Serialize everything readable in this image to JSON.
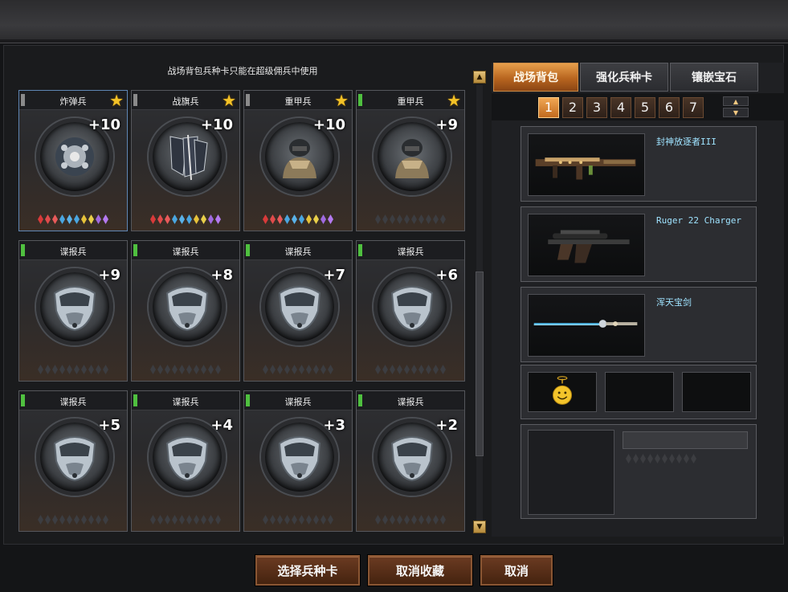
{
  "notice": "战场背包兵种卡只能在超级佣兵中使用",
  "cards": [
    {
      "name": "炸弹兵",
      "level": "+10",
      "star": true,
      "flag_color": "#8a8a8a",
      "emblem": "bomb-emblem-icon",
      "gems": "colored"
    },
    {
      "name": "战旗兵",
      "level": "+10",
      "star": true,
      "flag_color": "#8a8a8a",
      "emblem": "flag-emblem-icon",
      "gems": "colored"
    },
    {
      "name": "重甲兵",
      "level": "+10",
      "star": true,
      "flag_color": "#8a8a8a",
      "emblem": "heavy-armor-emblem-icon",
      "gems": "colored"
    },
    {
      "name": "重甲兵",
      "level": "+9",
      "star": true,
      "flag_color": "#4fc03f",
      "emblem": "heavy-armor-emblem-icon",
      "gems": "empty"
    },
    {
      "name": "谍报兵",
      "level": "+9",
      "star": false,
      "flag_color": "#4fc03f",
      "emblem": "spy-mask-emblem-icon",
      "gems": "empty"
    },
    {
      "name": "谍报兵",
      "level": "+8",
      "star": false,
      "flag_color": "#4fc03f",
      "emblem": "spy-mask-emblem-icon",
      "gems": "empty"
    },
    {
      "name": "谍报兵",
      "level": "+7",
      "star": false,
      "flag_color": "#4fc03f",
      "emblem": "spy-mask-emblem-icon",
      "gems": "empty"
    },
    {
      "name": "谍报兵",
      "level": "+6",
      "star": false,
      "flag_color": "#4fc03f",
      "emblem": "spy-mask-emblem-icon",
      "gems": "empty"
    },
    {
      "name": "谍报兵",
      "level": "+5",
      "star": false,
      "flag_color": "#4fc03f",
      "emblem": "spy-mask-emblem-icon",
      "gems": "empty"
    },
    {
      "name": "谍报兵",
      "level": "+4",
      "star": false,
      "flag_color": "#4fc03f",
      "emblem": "spy-mask-emblem-icon",
      "gems": "empty"
    },
    {
      "name": "谍报兵",
      "level": "+3",
      "star": false,
      "flag_color": "#4fc03f",
      "emblem": "spy-mask-emblem-icon",
      "gems": "empty"
    },
    {
      "name": "谍报兵",
      "level": "+2",
      "star": false,
      "flag_color": "#4fc03f",
      "emblem": "spy-mask-emblem-icon",
      "gems": "empty"
    }
  ],
  "tabs": [
    {
      "label": "战场背包",
      "active": true
    },
    {
      "label": "强化兵种卡",
      "active": false
    },
    {
      "label": "镶嵌宝石",
      "active": false
    }
  ],
  "pages": [
    "1",
    "2",
    "3",
    "4",
    "5",
    "6",
    "7"
  ],
  "active_page": "1",
  "weapons": [
    {
      "name": "封神放逐者III",
      "image": "machine-gun-icon"
    },
    {
      "name": "Ruger 22 Charger",
      "image": "scoped-pistol-icon"
    },
    {
      "name": "浑天宝剑",
      "image": "sword-icon"
    }
  ],
  "accessory_slots": [
    "smiley-face-icon",
    "empty-slot",
    "empty-slot"
  ],
  "buttons": {
    "select": "选择兵种卡",
    "unfavorite": "取消收藏",
    "cancel": "取消"
  },
  "colors": {
    "accent_orange": "#c16a1e",
    "weapon_name": "#9fe3ff",
    "star": "#f3c227"
  }
}
